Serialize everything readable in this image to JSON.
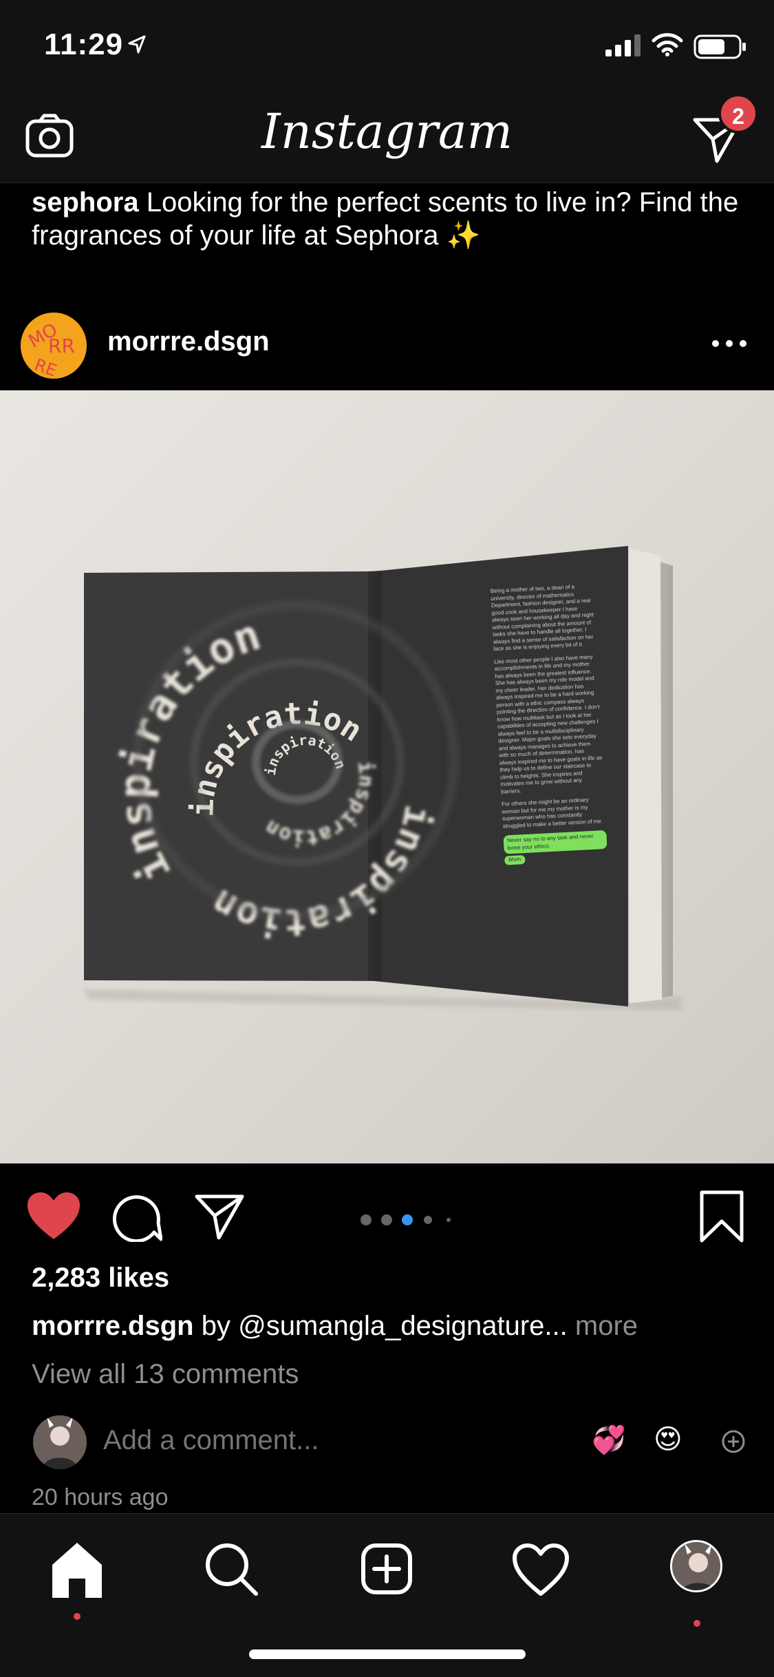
{
  "status_bar": {
    "time": "11:29"
  },
  "app": {
    "logo_text": "Instagram",
    "dm_badge": "2"
  },
  "prev_post": {
    "username": "sephora",
    "caption": "Looking for the perfect scents to live in? Find the fragrances of your life at Sephora ✨"
  },
  "post": {
    "username": "morrre.dsgn",
    "avatar_letters": "MORRRE",
    "likes": "2,283 likes",
    "caption_user": "morrre.dsgn",
    "caption_text": " by @sumangla_designature...",
    "caption_more": " more",
    "view_comments": "View all 13 comments",
    "comment_placeholder": "Add a comment...",
    "emoji_1": "💞",
    "emoji_2": "😍",
    "timestamp": "20 hours ago",
    "carousel": {
      "count": 5,
      "active_index": 2
    },
    "image_text": {
      "spiral_word": "inspiration",
      "page_para_1": "Being a mother of two, a dean of a university, director of mathematics Department, fashion designer, and a real good cook and housekeeper I have always seen her working all day and night without complaining about the amount of tasks she have to handle all together. I always find a sense of satisfaction on her face as she is enjoying every bit of it.",
      "page_para_2": "Like most other people I also have many accomplishments in life and my mother has always been the greatest influence. She has always been my role model and my cheer leader. Her dedication has always inspired me to be a hard working person with a ethic compass always pointing the direction of confidence. I don't know how multitask but as I look at her capabilities of accepting new challenges I always feel to be a multidisciplinary designer. Major goals she sets everyday and always manages to achieve them with so much of determination, has always inspired me to have goals in life as they help us to define our staircase to climb to heights. She inspires and motivates me to grow without any barriers.",
      "page_para_3": "For others she might be an ordinary woman but for me my mother is my superwoman who has constantly struggled to make a better version of me.",
      "highlight_1": "Never say no to any task and never loose your ethics.",
      "highlight_2": "Mom"
    }
  },
  "colors": {
    "accent_red": "#e0454d",
    "carousel_active": "#3897f0",
    "green_highlight": "#7ee05c"
  },
  "icons": [
    "camera-icon",
    "direct-icon",
    "more-icon",
    "heart-icon",
    "comment-icon",
    "share-icon",
    "bookmark-icon",
    "home-icon",
    "search-icon",
    "new-post-icon",
    "activity-icon"
  ]
}
